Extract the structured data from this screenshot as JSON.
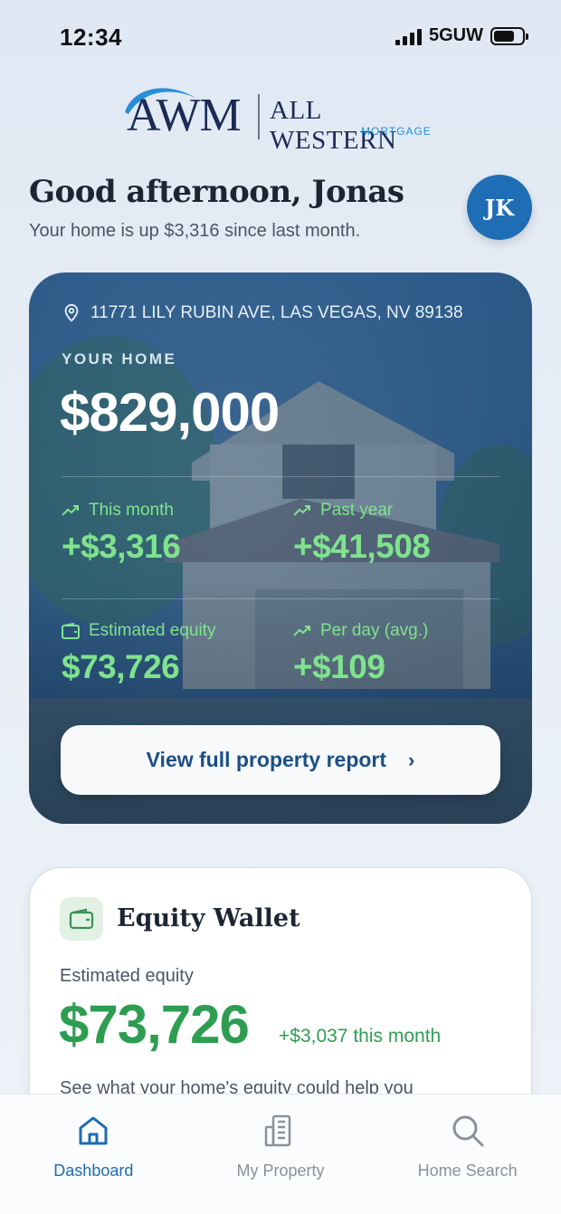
{
  "status_bar": {
    "time": "12:34",
    "network": "5GUW"
  },
  "logo": {
    "mark": "AWM",
    "name": "ALL WESTERN",
    "sub": "MORTGAGE"
  },
  "greeting": {
    "title": "Good afternoon, Jonas",
    "subtitle": "Your home is up $3,316 since last month.",
    "avatar_initials": "JK"
  },
  "home_card": {
    "address": "11771 LILY RUBIN AVE, LAS VEGAS, NV 89138",
    "label": "YOUR HOME",
    "value": "$829,000",
    "stats": [
      {
        "label": "This month",
        "value": "+$3,316",
        "icon": "trend-up-icon"
      },
      {
        "label": "Past year",
        "value": "+$41,508",
        "icon": "trend-up-icon"
      },
      {
        "label": "Estimated equity",
        "value": "$73,726",
        "icon": "wallet-icon"
      },
      {
        "label": "Per day (avg.)",
        "value": "+$109",
        "icon": "trend-up-icon"
      }
    ],
    "button_label": "View full property report"
  },
  "equity_wallet": {
    "title": "Equity Wallet",
    "label": "Estimated equity",
    "value": "$73,726",
    "change": "+$3,037 this month",
    "description": "See what your home's equity could help you"
  },
  "tabs": [
    {
      "label": "Dashboard",
      "icon": "home-icon",
      "active": true
    },
    {
      "label": "My Property",
      "icon": "building-icon",
      "active": false
    },
    {
      "label": "Home Search",
      "icon": "search-icon",
      "active": false
    }
  ],
  "colors": {
    "accent": "#1d6cb5",
    "positive": "#2e9d52",
    "stat_green": "#7fe38e"
  }
}
